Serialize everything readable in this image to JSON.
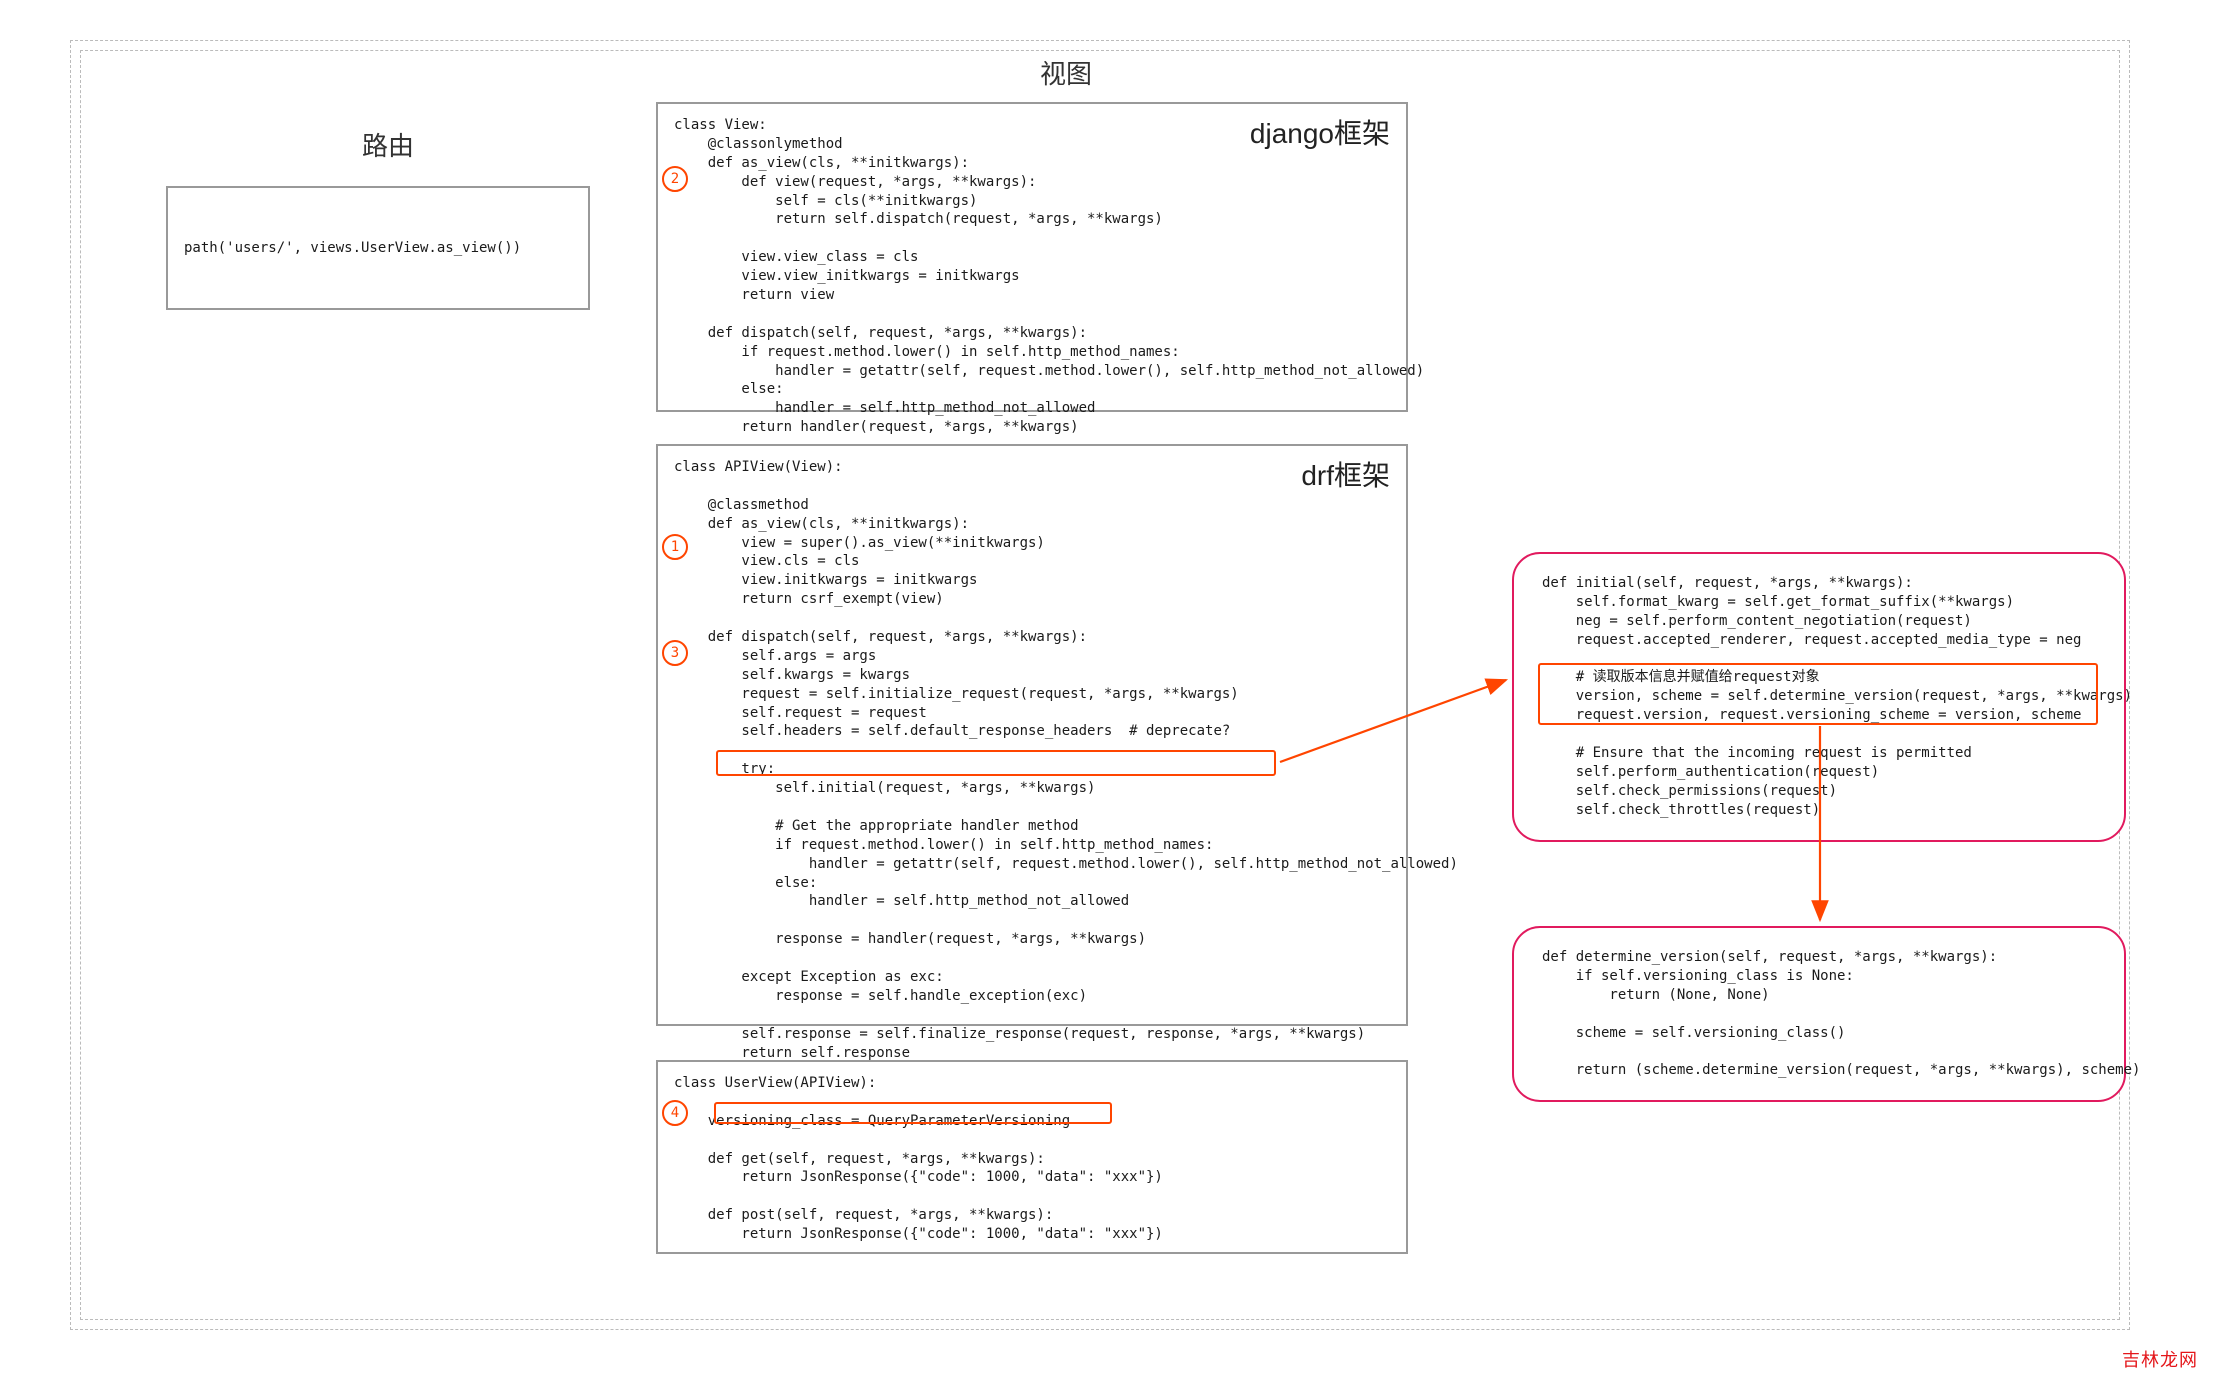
{
  "titles": {
    "view": "视图",
    "route": "路由"
  },
  "route_panel": {
    "code": "path('users/', views.UserView.as_view())"
  },
  "django_panel": {
    "label": "django框架",
    "code": "class View:\n    @classonlymethod\n    def as_view(cls, **initkwargs):\n        def view(request, *args, **kwargs):\n            self = cls(**initkwargs)\n            return self.dispatch(request, *args, **kwargs)\n\n        view.view_class = cls\n        view.view_initkwargs = initkwargs\n        return view\n\n    def dispatch(self, request, *args, **kwargs):\n        if request.method.lower() in self.http_method_names:\n            handler = getattr(self, request.method.lower(), self.http_method_not_allowed)\n        else:\n            handler = self.http_method_not_allowed\n        return handler(request, *args, **kwargs)"
  },
  "drf_panel": {
    "label": "drf框架",
    "code": "class APIView(View):\n\n    @classmethod\n    def as_view(cls, **initkwargs):\n        view = super().as_view(**initkwargs)\n        view.cls = cls\n        view.initkwargs = initkwargs\n        return csrf_exempt(view)\n\n    def dispatch(self, request, *args, **kwargs):\n        self.args = args\n        self.kwargs = kwargs\n        request = self.initialize_request(request, *args, **kwargs)\n        self.request = request\n        self.headers = self.default_response_headers  # deprecate?\n\n        try:\n            self.initial(request, *args, **kwargs)\n\n            # Get the appropriate handler method\n            if request.method.lower() in self.http_method_names:\n                handler = getattr(self, request.method.lower(), self.http_method_not_allowed)\n            else:\n                handler = self.http_method_not_allowed\n\n            response = handler(request, *args, **kwargs)\n\n        except Exception as exc:\n            response = self.handle_exception(exc)\n\n        self.response = self.finalize_response(request, response, *args, **kwargs)\n        return self.response"
  },
  "userview_panel": {
    "code": "class UserView(APIView):\n\n    versioning_class = QueryParameterVersioning\n\n    def get(self, request, *args, **kwargs):\n        return JsonResponse({\"code\": 1000, \"data\": \"xxx\"})\n\n    def post(self, request, *args, **kwargs):\n        return JsonResponse({\"code\": 1000, \"data\": \"xxx\"})"
  },
  "initial_callout": {
    "code": "def initial(self, request, *args, **kwargs):\n    self.format_kwarg = self.get_format_suffix(**kwargs)\n    neg = self.perform_content_negotiation(request)\n    request.accepted_renderer, request.accepted_media_type = neg\n\n    # 读取版本信息并赋值给request对象\n    version, scheme = self.determine_version(request, *args, **kwargs)\n    request.version, request.versioning_scheme = version, scheme\n\n    # Ensure that the incoming request is permitted\n    self.perform_authentication(request)\n    self.check_permissions(request)\n    self.check_throttles(request)"
  },
  "determine_callout": {
    "code": "def determine_version(self, request, *args, **kwargs):\n    if self.versioning_class is None:\n        return (None, None)\n\n    scheme = self.versioning_class()\n\n    return (scheme.determine_version(request, *args, **kwargs), scheme)"
  },
  "circles": {
    "c1": "1",
    "c2": "2",
    "c3": "3",
    "c4": "4"
  },
  "watermark": "吉林龙网"
}
